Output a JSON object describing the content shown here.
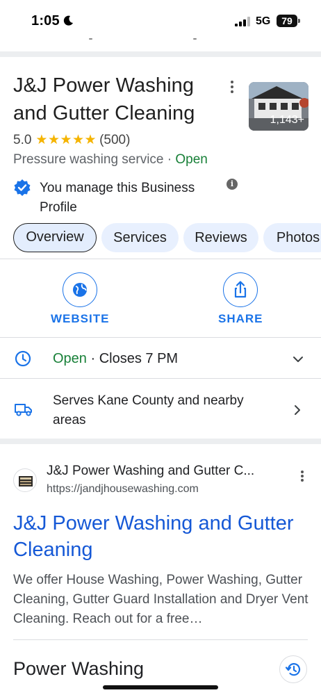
{
  "status_bar": {
    "time": "1:05",
    "network": "5G",
    "battery": "79"
  },
  "business": {
    "title": "J&J Power Washing and Gutter Cleaning",
    "photo_count": "1,143+",
    "rating": "5.0",
    "stars": "★★★★★",
    "review_count": "(500)",
    "category": "Pressure washing service",
    "separator": " · ",
    "open_status": "Open",
    "manage_text": "You manage this Business Profile",
    "info_glyph": "i"
  },
  "tabs": [
    {
      "label": "Overview"
    },
    {
      "label": "Services"
    },
    {
      "label": "Reviews"
    },
    {
      "label": "Photos"
    }
  ],
  "actions": {
    "website": "WEBSITE",
    "share": "SHARE"
  },
  "hours": {
    "status": "Open",
    "separator": " · ",
    "closes": "Closes 7 PM"
  },
  "service_area": {
    "text": "Serves Kane County and nearby areas"
  },
  "search_result": {
    "site_name": "J&J Power Washing and Gutter C...",
    "url": "https://jandjhousewashing.com",
    "title": "J&J Power Washing and Gutter Cleaning",
    "snippet": "We offer House Washing, Power Washing, Gutter Cleaning, Gutter Guard Installation and Dryer Vent Cleaning. Reach out for a free…"
  },
  "next_section": {
    "heading": "Power Washing"
  },
  "colors": {
    "accent": "#1a73e8",
    "open_green": "#188038",
    "star": "#f5b400",
    "link": "#1558d6"
  }
}
